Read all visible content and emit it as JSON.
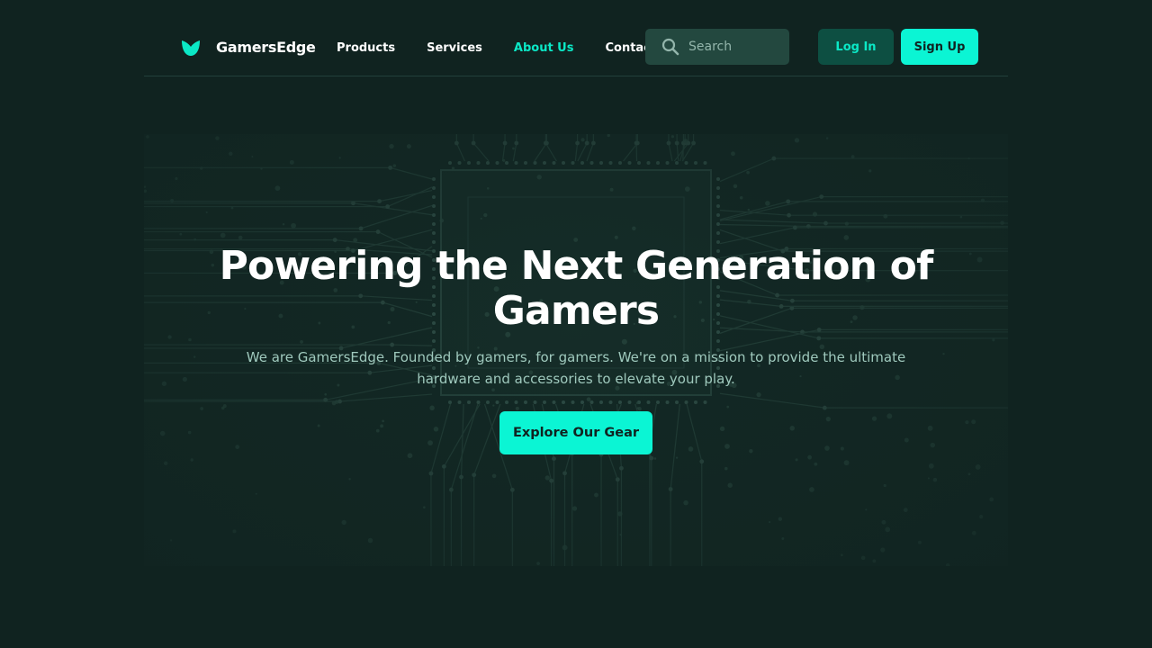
{
  "brand": {
    "name": "GamersEdge",
    "logo_icon": "leaf-logo-icon",
    "accent": "#0be8c6"
  },
  "nav": {
    "items": [
      {
        "label": "Products",
        "active": false
      },
      {
        "label": "Services",
        "active": false
      },
      {
        "label": "About Us",
        "active": true
      },
      {
        "label": "Contact",
        "active": false
      }
    ]
  },
  "search": {
    "placeholder": "Search",
    "value": "",
    "icon": "search-icon"
  },
  "auth": {
    "login_label": "Log In",
    "signup_label": "Sign Up"
  },
  "hero": {
    "title": "Powering the Next Generation of Gamers",
    "subtitle": "We are GamersEdge. Founded by gamers, for gamers. We're on a mission to provide the ultimate hardware and accessories to elevate your play.",
    "cta_label": "Explore Our Gear",
    "background": "circuit-board-image"
  },
  "colors": {
    "background": "#102320",
    "primary_button": "#0bf5d4",
    "secondary_button": "#0d4f42",
    "search_bg": "#23483f"
  }
}
